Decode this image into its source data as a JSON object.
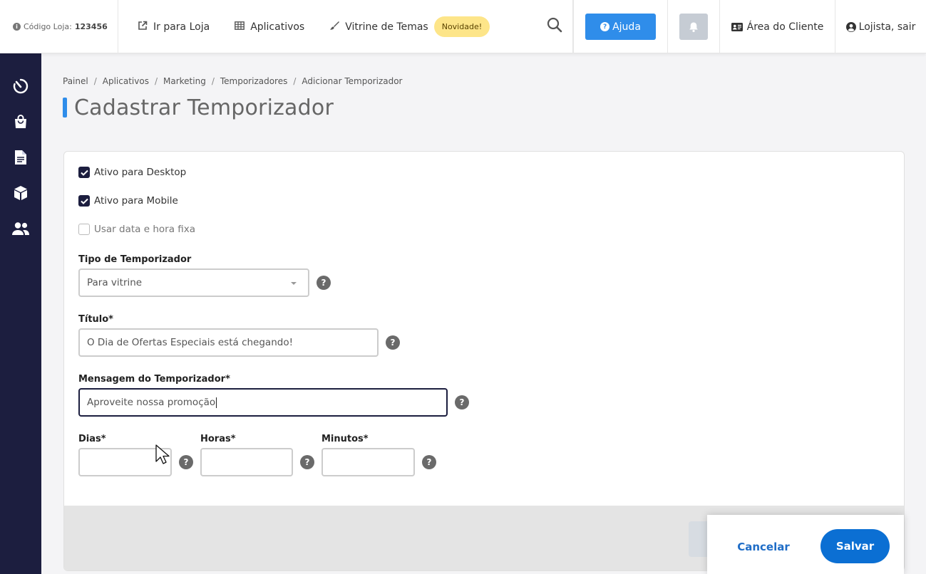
{
  "topbar": {
    "store_code_label": "Código Loja:",
    "store_code_value": "123456",
    "nav": [
      {
        "label": "Ir para Loja",
        "icon": "external-link-icon"
      },
      {
        "label": "Aplicativos",
        "icon": "grid-icon"
      },
      {
        "label": "Vitrine de Temas",
        "icon": "brush-icon"
      }
    ],
    "badge": "Novidade!",
    "help_label": "Ajuda",
    "client_area_label": "Área do Cliente",
    "logout_label": "Lojista, sair"
  },
  "sidebar": {
    "items": [
      {
        "icon": "dashboard-timer-icon"
      },
      {
        "icon": "shopping-bag-icon"
      },
      {
        "icon": "document-icon"
      },
      {
        "icon": "box-icon"
      },
      {
        "icon": "users-icon"
      }
    ]
  },
  "breadcrumb": [
    "Painel",
    "Aplicativos",
    "Marketing",
    "Temporizadores",
    "Adicionar Temporizador"
  ],
  "page_title": "Cadastrar Temporizador",
  "form": {
    "checkboxes": [
      {
        "label": "Ativo para Desktop",
        "checked": true
      },
      {
        "label": "Ativo para Mobile",
        "checked": true
      },
      {
        "label": "Usar data e hora fixa",
        "checked": false
      }
    ],
    "tipo_label": "Tipo de Temporizador",
    "tipo_value": "Para vitrine",
    "titulo_label": "Título*",
    "titulo_value": "O Dia de Ofertas Especiais está chegando!",
    "mensagem_label": "Mensagem do Temporizador*",
    "mensagem_value": "Aproveite nossa promoção",
    "dias_label": "Dias*",
    "horas_label": "Horas*",
    "minutos_label": "Minutos*",
    "dias_value": "",
    "horas_value": "",
    "minutos_value": "",
    "help_glyph": "?"
  },
  "actions": {
    "cancel_label": "Cancelar",
    "save_label": "Salvar"
  },
  "colors": {
    "sidebar": "#1c1e3f",
    "accent": "#2f8dea",
    "save": "#0b6fd3",
    "badge": "#fde589"
  }
}
